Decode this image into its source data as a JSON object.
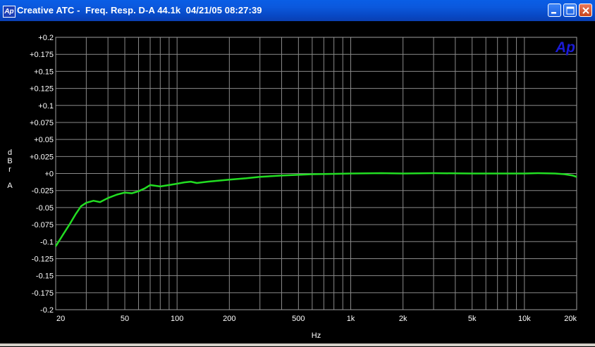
{
  "window": {
    "title": "Creative ATC -  Freq. Resp. D-A 44.1k  04/21/05 08:27:39",
    "app_icon_text": "Ap",
    "titlebar_color": "#0b58dc"
  },
  "logo": {
    "text": "Ap",
    "color": "#1b1bd6"
  },
  "chart_data": {
    "type": "line",
    "title": "",
    "xlabel": "Hz",
    "ylabel": "dBr A",
    "x_scale": "log",
    "xlim": [
      20,
      20000
    ],
    "ylim": [
      -0.2,
      0.2
    ],
    "x_ticks": [
      20,
      50,
      100,
      200,
      500,
      1000,
      2000,
      5000,
      10000,
      20000
    ],
    "x_tick_labels": [
      "20",
      "50",
      "100",
      "200",
      "500",
      "1k",
      "2k",
      "5k",
      "10k",
      "20k"
    ],
    "y_ticks": [
      0.2,
      0.175,
      0.15,
      0.125,
      0.1,
      0.075,
      0.05,
      0.025,
      0,
      -0.025,
      -0.05,
      -0.075,
      -0.1,
      -0.125,
      -0.15,
      -0.175,
      -0.2
    ],
    "y_tick_labels": [
      "+0.2",
      "+0.175",
      "+0.15",
      "+0.125",
      "+0.1",
      "+0.075",
      "+0.05",
      "+0.025",
      "+0",
      "-0.025",
      "-0.05",
      "-0.075",
      "-0.1",
      "-0.125",
      "-0.15",
      "-0.175",
      "-0.2"
    ],
    "grid": true,
    "grid_color": "#8a8a8a",
    "background": "#000000",
    "series": [
      {
        "color": "#22dd22",
        "x": [
          20,
          22,
          24,
          26,
          28,
          30,
          33,
          36,
          40,
          45,
          50,
          55,
          60,
          65,
          70,
          80,
          90,
          100,
          110,
          120,
          130,
          150,
          200,
          250,
          300,
          400,
          500,
          600,
          800,
          1000,
          1500,
          2000,
          3000,
          5000,
          8000,
          10000,
          12000,
          15000,
          17000,
          19000,
          20000
        ],
        "y": [
          -0.107,
          -0.09,
          -0.075,
          -0.06,
          -0.048,
          -0.043,
          -0.04,
          -0.042,
          -0.036,
          -0.031,
          -0.028,
          -0.029,
          -0.026,
          -0.022,
          -0.017,
          -0.019,
          -0.017,
          -0.015,
          -0.013,
          -0.012,
          -0.014,
          -0.012,
          -0.009,
          -0.007,
          -0.005,
          -0.003,
          -0.002,
          -0.001,
          -0.0005,
          0.0,
          0.0005,
          0.0,
          0.0005,
          0.0,
          0.0,
          0.0,
          0.0005,
          0.0,
          -0.001,
          -0.003,
          -0.005
        ]
      }
    ]
  }
}
